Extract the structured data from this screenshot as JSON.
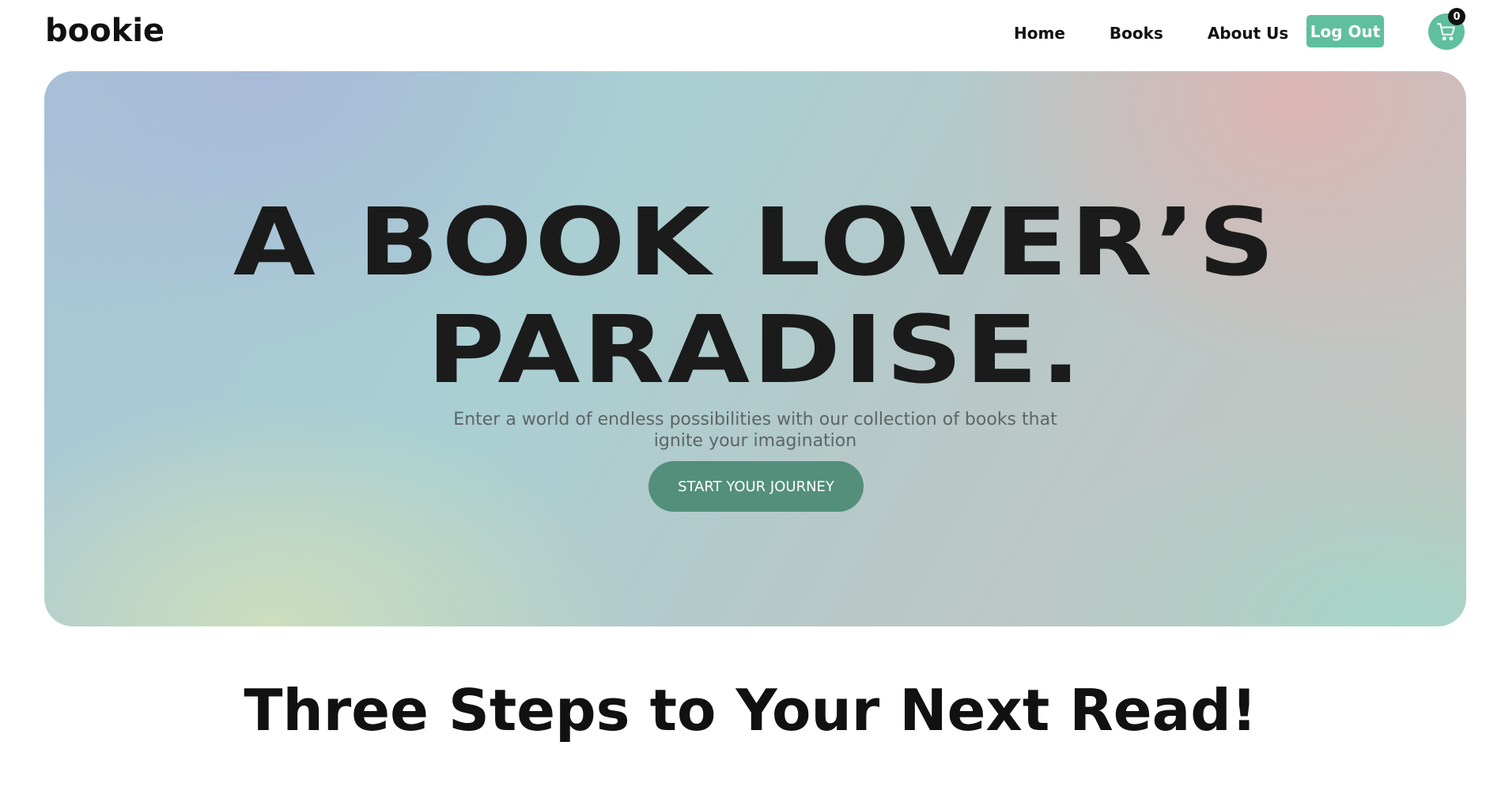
{
  "brand": {
    "logo_text": "bookie"
  },
  "nav": {
    "links": [
      {
        "label": "Home"
      },
      {
        "label": "Books"
      },
      {
        "label": "About Us"
      }
    ],
    "logout_label": "Log Out",
    "cart_count": "0",
    "cart_icon": "shopping-cart-icon",
    "accent_color": "#5fbf9e"
  },
  "hero": {
    "title_line1": "A BOOK LOVER’S",
    "title_line2": "PARADISE.",
    "subtitle": "Enter a world of endless possibilities with our collection of books that ignite your imagination",
    "cta_label": "START YOUR JOURNEY",
    "cta_color": "#538f7b"
  },
  "section": {
    "title": "Three Steps to Your Next Read!"
  }
}
